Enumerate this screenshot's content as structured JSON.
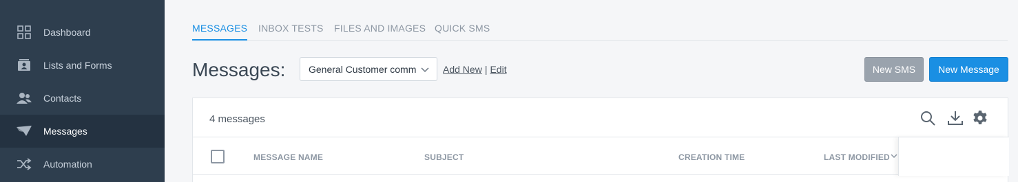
{
  "sidebar": {
    "items": [
      {
        "label": "Dashboard",
        "icon": "grid-icon",
        "active": false
      },
      {
        "label": "Lists and Forms",
        "icon": "contact-card-icon",
        "active": false
      },
      {
        "label": "Contacts",
        "icon": "people-icon",
        "active": false
      },
      {
        "label": "Messages",
        "icon": "paper-plane-icon",
        "active": true
      },
      {
        "label": "Automation",
        "icon": "shuffle-icon",
        "active": false
      }
    ]
  },
  "tabs": [
    {
      "label": "MESSAGES",
      "active": true
    },
    {
      "label": "INBOX TESTS",
      "active": false
    },
    {
      "label": "FILES AND IMAGES",
      "active": false
    },
    {
      "label": "QUICK SMS",
      "active": false
    }
  ],
  "header": {
    "title": "Messages:",
    "list_select_value": "General Customer comm",
    "add_new_label": "Add New",
    "separator": "|",
    "edit_label": "Edit",
    "new_sms_label": "New SMS",
    "new_message_label": "New Message"
  },
  "panel": {
    "count_text": "4 messages",
    "toolbar_icons": [
      "search-icon",
      "download-icon",
      "gear-icon"
    ]
  },
  "table": {
    "columns": [
      "MESSAGE NAME",
      "SUBJECT",
      "CREATION TIME",
      "LAST MODIFIED"
    ],
    "sorted_column": "LAST MODIFIED",
    "sort_direction": "descending"
  },
  "colors": {
    "sidebar_bg": "#2e3e4e",
    "sidebar_active_bg": "#243241",
    "accent": "#1a8fe3",
    "secondary_button": "#9aa3ad"
  }
}
